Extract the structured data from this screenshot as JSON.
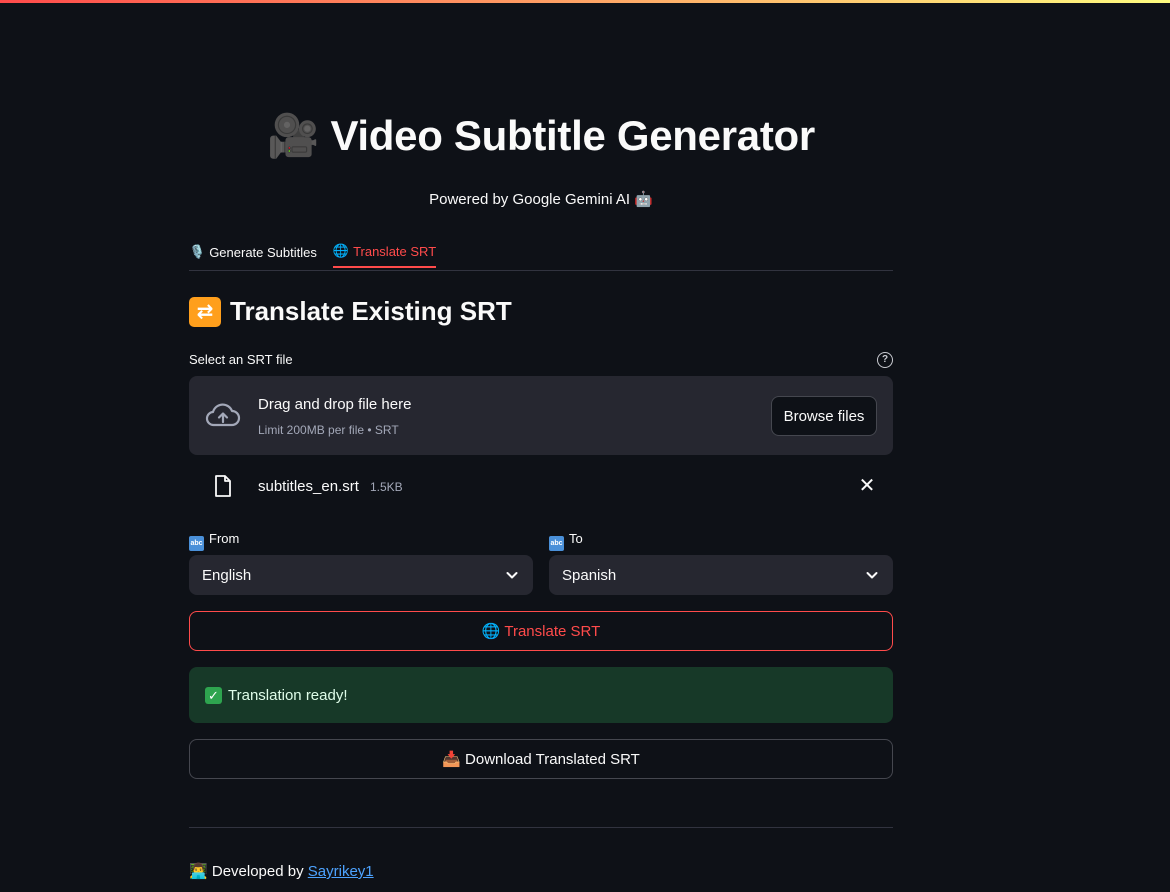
{
  "app": {
    "title": "Video Subtitle Generator",
    "title_icon": "🎥",
    "subtitle": "Powered by Google Gemini AI 🤖"
  },
  "tabs": [
    {
      "icon": "🎙️",
      "label": "Generate Subtitles",
      "active": false
    },
    {
      "icon": "🌐",
      "label": "Translate SRT",
      "active": true
    }
  ],
  "section": {
    "icon": "🔁",
    "title": "Translate Existing SRT"
  },
  "uploader": {
    "label": "Select an SRT file",
    "drop_text": "Drag and drop file here",
    "limit_text": "Limit 200MB per file • SRT",
    "browse_label": "Browse files",
    "file": {
      "name": "subtitles_en.srt",
      "size": "1.5KB"
    }
  },
  "from": {
    "icon": "abc",
    "label": "From",
    "value": "English"
  },
  "to": {
    "icon": "abc",
    "label": "To",
    "value": "Spanish"
  },
  "translate_button": {
    "icon": "🌐",
    "label": "Translate SRT"
  },
  "success": {
    "icon": "✓",
    "message": "Translation ready!"
  },
  "download_button": {
    "icon": "📥",
    "label": "Download Translated SRT"
  },
  "footer": {
    "icon": "👨‍💻",
    "prefix": "Developed by",
    "link_text": "Sayrikey1"
  },
  "colors": {
    "background": "#0e1117",
    "accent": "#ff4b4b",
    "widget_bg": "#262730",
    "success_bg": "#173928",
    "link": "#4da3ff"
  }
}
